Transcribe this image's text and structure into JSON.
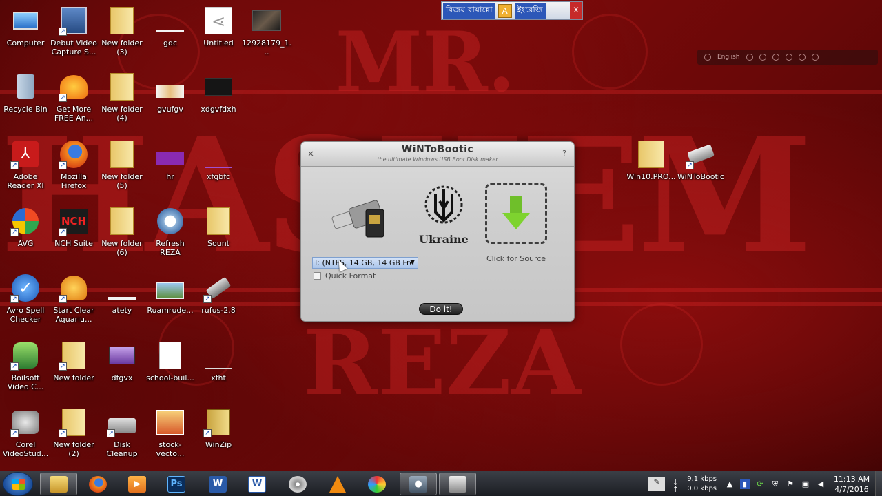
{
  "langbar": {
    "bangla": "বিজয় বায়ান্নো",
    "english": "ইংরেজি",
    "close": "x"
  },
  "imebar": {
    "lang": "English"
  },
  "desktop_icons": [
    {
      "label": "Computer"
    },
    {
      "label": "Debut Video Capture S..."
    },
    {
      "label": "New folder (3)"
    },
    {
      "label": "gdc"
    },
    {
      "label": "Untitled"
    },
    {
      "label": "12928179_1..."
    },
    {
      "label": "Recycle Bin"
    },
    {
      "label": "Get More FREE An..."
    },
    {
      "label": "New folder (4)"
    },
    {
      "label": "gvufgv"
    },
    {
      "label": "xdgvfdxh"
    },
    {
      "label": "Adobe Reader XI"
    },
    {
      "label": "Mozilla Firefox"
    },
    {
      "label": "New folder (5)"
    },
    {
      "label": "hr"
    },
    {
      "label": "xfgbfc"
    },
    {
      "label": "AVG"
    },
    {
      "label": "NCH Suite"
    },
    {
      "label": "New folder (6)"
    },
    {
      "label": "Refresh REZA"
    },
    {
      "label": "Sount"
    },
    {
      "label": "Avro Spell Checker"
    },
    {
      "label": "Start Clear Aquariu..."
    },
    {
      "label": "atety"
    },
    {
      "label": "Ruamrude..."
    },
    {
      "label": "rufus-2.8"
    },
    {
      "label": "Boilsoft Video C..."
    },
    {
      "label": "New folder"
    },
    {
      "label": "dfgvx"
    },
    {
      "label": "school-buil..."
    },
    {
      "label": "xfht"
    },
    {
      "label": "Corel VideoStud..."
    },
    {
      "label": "New folder (2)"
    },
    {
      "label": "Disk Cleanup"
    },
    {
      "label": "stock-vecto..."
    },
    {
      "label": "WinZip"
    },
    {
      "label": "Win10.PRO..."
    },
    {
      "label": "WiNToBootic"
    }
  ],
  "wallpaper": {
    "line1": "MR.",
    "line2": "HASHEM",
    "line3": "REZA"
  },
  "dialog": {
    "title": "WiNToBootic",
    "subtitle": "the ultimate Windows USB Boot Disk maker",
    "close": "×",
    "help": "?",
    "ukraine_label": "Ukraine",
    "source_label": "Click for Source",
    "drive_value": "I: (NTFS, 14 GB, 14 GB Fre",
    "quick_format_label": "Quick Format",
    "doit_label": "Do it!"
  },
  "taskbar": {
    "apps": [
      {
        "icon": "explorer-icon"
      },
      {
        "icon": "firefox-icon"
      },
      {
        "icon": "media-player-icon"
      },
      {
        "icon": "photoshop-icon",
        "text": "Ps"
      },
      {
        "icon": "word-icon",
        "text": "W"
      },
      {
        "icon": "word-doc-icon",
        "text": "W"
      },
      {
        "icon": "disk-icon"
      },
      {
        "icon": "vlc-icon"
      },
      {
        "icon": "paint-icon"
      },
      {
        "icon": "recorder-icon"
      },
      {
        "icon": "wintobootic-icon"
      }
    ],
    "net_down": "9.1 kbps",
    "net_up": "0.0 kbps",
    "time": "11:13 AM",
    "date": "4/7/2016"
  },
  "colors": {
    "wallpaper": "#7d0a0a",
    "accent": "#2c57b8"
  }
}
